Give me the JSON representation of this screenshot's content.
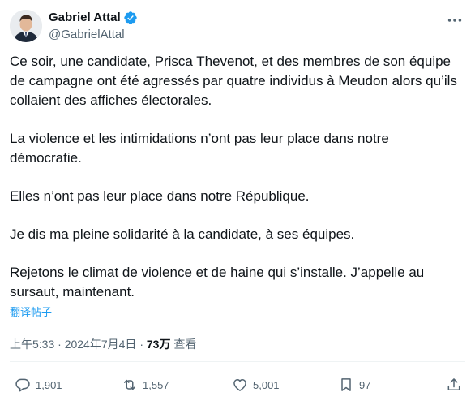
{
  "author": {
    "display_name": "Gabriel Attal",
    "handle": "@GabrielAttal",
    "verified": true
  },
  "icons": {
    "verified": "verified-badge-icon",
    "more": "more-dots-icon",
    "reply": "reply-icon",
    "repost": "repost-icon",
    "like": "like-icon",
    "bookmark": "bookmark-icon",
    "share": "share-icon"
  },
  "tweet": {
    "paragraphs": [
      "Ce soir, une candidate, Prisca Thevenot, et des membres de son équipe de campagne ont été agressés par quatre individus à Meudon alors qu’ils collaient des affiches électorales.",
      "La violence et les intimidations n’ont pas leur place dans notre démocratie.",
      "Elles n’ont pas leur place dans notre République.",
      "Je dis ma pleine solidarité à la candidate, à ses équipes.",
      "Rejetons le climat de violence et de haine qui s’installe. J’appelle au sursaut, maintenant."
    ],
    "translate_label": "翻译帖子"
  },
  "meta": {
    "time": "上午5:33",
    "separator": "·",
    "date": "2024年7月4日",
    "views_count": "73万",
    "views_label": "查看"
  },
  "actions": {
    "replies": "1,901",
    "reposts": "1,557",
    "likes": "5,001",
    "bookmarks": "97"
  },
  "colors": {
    "accent": "#1d9bf0",
    "text": "#0f1419",
    "secondary": "#536471",
    "divider": "#eff3f4"
  }
}
